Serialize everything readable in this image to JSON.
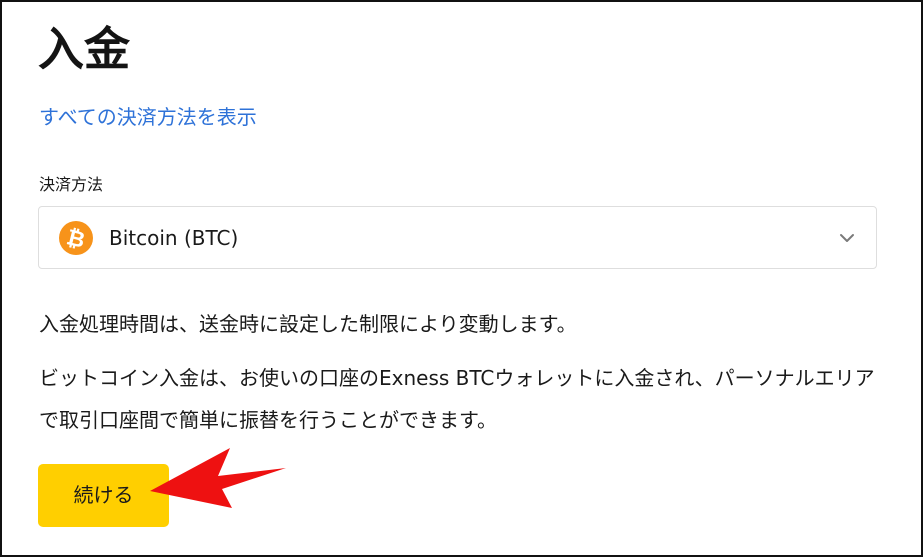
{
  "page": {
    "title": "入金",
    "show_all_methods_link": "すべての決済方法を表示"
  },
  "payment_method": {
    "label": "決済方法",
    "selected": "Bitcoin (BTC)",
    "icon": "bitcoin-icon",
    "icon_color": "#f7931a"
  },
  "info": {
    "processing_time": "入金処理時間は、送金時に設定した制限により変動します。",
    "description": "ビットコイン入金は、お使いの口座のExness BTCウォレットに入金され、パーソナルエリアで取引口座間で簡単に振替を行うことができます。"
  },
  "actions": {
    "continue_label": "続ける",
    "continue_color": "#ffcf00"
  },
  "annotation": {
    "arrow_color": "#ee1111"
  },
  "colors": {
    "link": "#2e72d8",
    "text": "#1a1a1a"
  }
}
